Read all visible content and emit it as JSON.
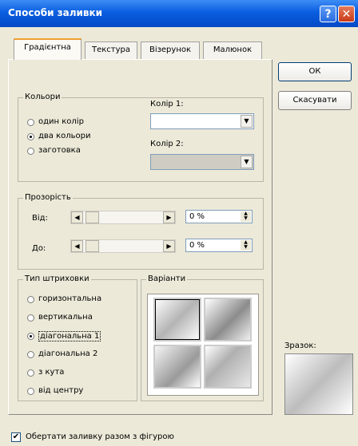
{
  "title": "Способи заливки",
  "tabs": [
    "Градієнтна",
    "Текстура",
    "Візерунок",
    "Малюнок"
  ],
  "colors_group": {
    "legend": "Кольори",
    "options": [
      "один колір",
      "два кольори",
      "заготовка"
    ],
    "selected": "два кольори",
    "color1_label": "Колір 1:",
    "color2_label": "Колір 2:"
  },
  "transparency_group": {
    "legend": "Прозорість",
    "from_label": "Від:",
    "to_label": "До:",
    "from_value": "0 %",
    "to_value": "0 %"
  },
  "shading_group": {
    "legend": "Тип штриховки",
    "options": [
      "горизонтальна",
      "вертикальна",
      "діагональна 1",
      "діагональна 2",
      "з кута",
      "від центру"
    ],
    "selected": "діагональна 1"
  },
  "variants_label": "Варіанти",
  "sample_label": "Зразок:",
  "buttons": {
    "ok": "ОК",
    "cancel": "Скасувати"
  },
  "rotate_checkbox": {
    "label": "Обертати заливку разом з фігурою",
    "checked": true
  },
  "icons": {
    "help": "help-icon",
    "close": "close-icon"
  },
  "accent_colors": {
    "titlebar": "#0a5ee0",
    "close": "#c93a16",
    "active_tab": "#f0a030"
  }
}
